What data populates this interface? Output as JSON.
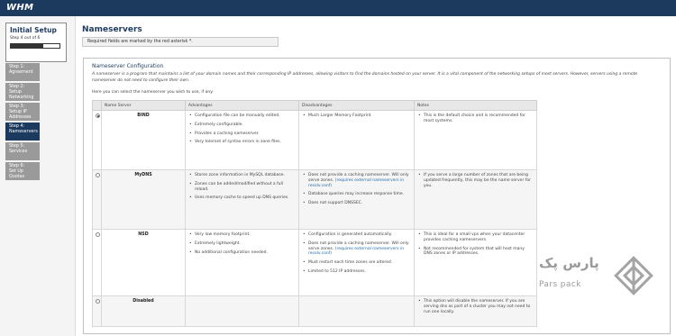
{
  "app": {
    "logo_text": "WHM"
  },
  "sidebar": {
    "setup_title": "Initial Setup",
    "setup_sub": "Step 4 out of 6",
    "progress": 0.667,
    "steps": [
      {
        "label": "Step 1:\nAgreement",
        "active": false
      },
      {
        "label": "Step 2:\nSetup Networking",
        "active": false
      },
      {
        "label": "Step 3:\nSetup IP Addresses",
        "active": false
      },
      {
        "label": "Step 4:\nNameservers",
        "active": true
      },
      {
        "label": "Step 5:\nServices",
        "active": false
      },
      {
        "label": "Step 6:\nSet Up Quotas",
        "active": false
      }
    ]
  },
  "main": {
    "page_title": "Nameservers",
    "required_note": "Required fields are marked by the red asterisk *.",
    "config_title": "Nameserver Configuration",
    "config_desc": "A nameserver is a program that maintains a list of your domain names and their corresponding IP addresses, allowing visitors to find the domains hosted on your server. It is a vital component of the networking setups of most servers. However, servers using a remote nameserver do not need to configure their own.",
    "config_here": "Here you can select the nameserver you wish to use, if any.",
    "table": {
      "headers": [
        "Name Server",
        "Advantages",
        "Disadvantages",
        "Notes"
      ],
      "rows": [
        {
          "name": "BIND",
          "selected": true,
          "advantages": [
            "Configuration file can be manually edited.",
            "Extremely configurable.",
            "Provides a caching nameserver.",
            "Very tolerant of syntax errors in zone files."
          ],
          "disadvantages": [
            "Much Larger Memory Footprint"
          ],
          "notes": "This is the default choice and is recommended for most systems."
        },
        {
          "name": "MyDNS",
          "selected": false,
          "advantages": [
            "Stores zone information in MySQL database.",
            "Zones can be added/modified without a full reload.",
            "Uses memory cache to speed up DNS queries."
          ],
          "disadvantages": [
            "Does not provide a caching nameserver. Will only serve zones.",
            "Database queries may increase response time.",
            "Does not support DNSSEC."
          ],
          "disadvantage_link": "(requires external nameservers in resolv.conf)",
          "notes": "If you serve a large number of zones that are being updated frequently, this may be the name server for you."
        },
        {
          "name": "NSD",
          "selected": false,
          "advantages": [
            "Very low memory footprint.",
            "Extremely lightweight.",
            "No additional configuration needed."
          ],
          "disadvantages": [
            "Configuration is generated automatically.",
            "Does not provide a caching nameserver. Will only serve zones.",
            "Must restart each time zones are altered.",
            "Limited to 512 IP addresses."
          ],
          "disadvantage_link": "(requires external nameservers in resolv.conf)",
          "notes_list": [
            "This is ideal for a small vps when your datacenter provides caching nameservers.",
            "Not recommended for system that will host many DNS zones or IP addresses."
          ]
        },
        {
          "name": "Disabled",
          "selected": false,
          "advantages": [],
          "disadvantages": [],
          "notes": "This option will disable the nameserver. If you are serving dns as part of a cluster you may not need to run one locally."
        }
      ]
    }
  },
  "watermark": {
    "fa": "پارس پک",
    "en": "Pars pack"
  },
  "colors": {
    "topbar": "#1b3a5e",
    "accent": "#1d3a5f",
    "link": "#1f6aa8",
    "step_inactive": "#9a9a9a"
  }
}
